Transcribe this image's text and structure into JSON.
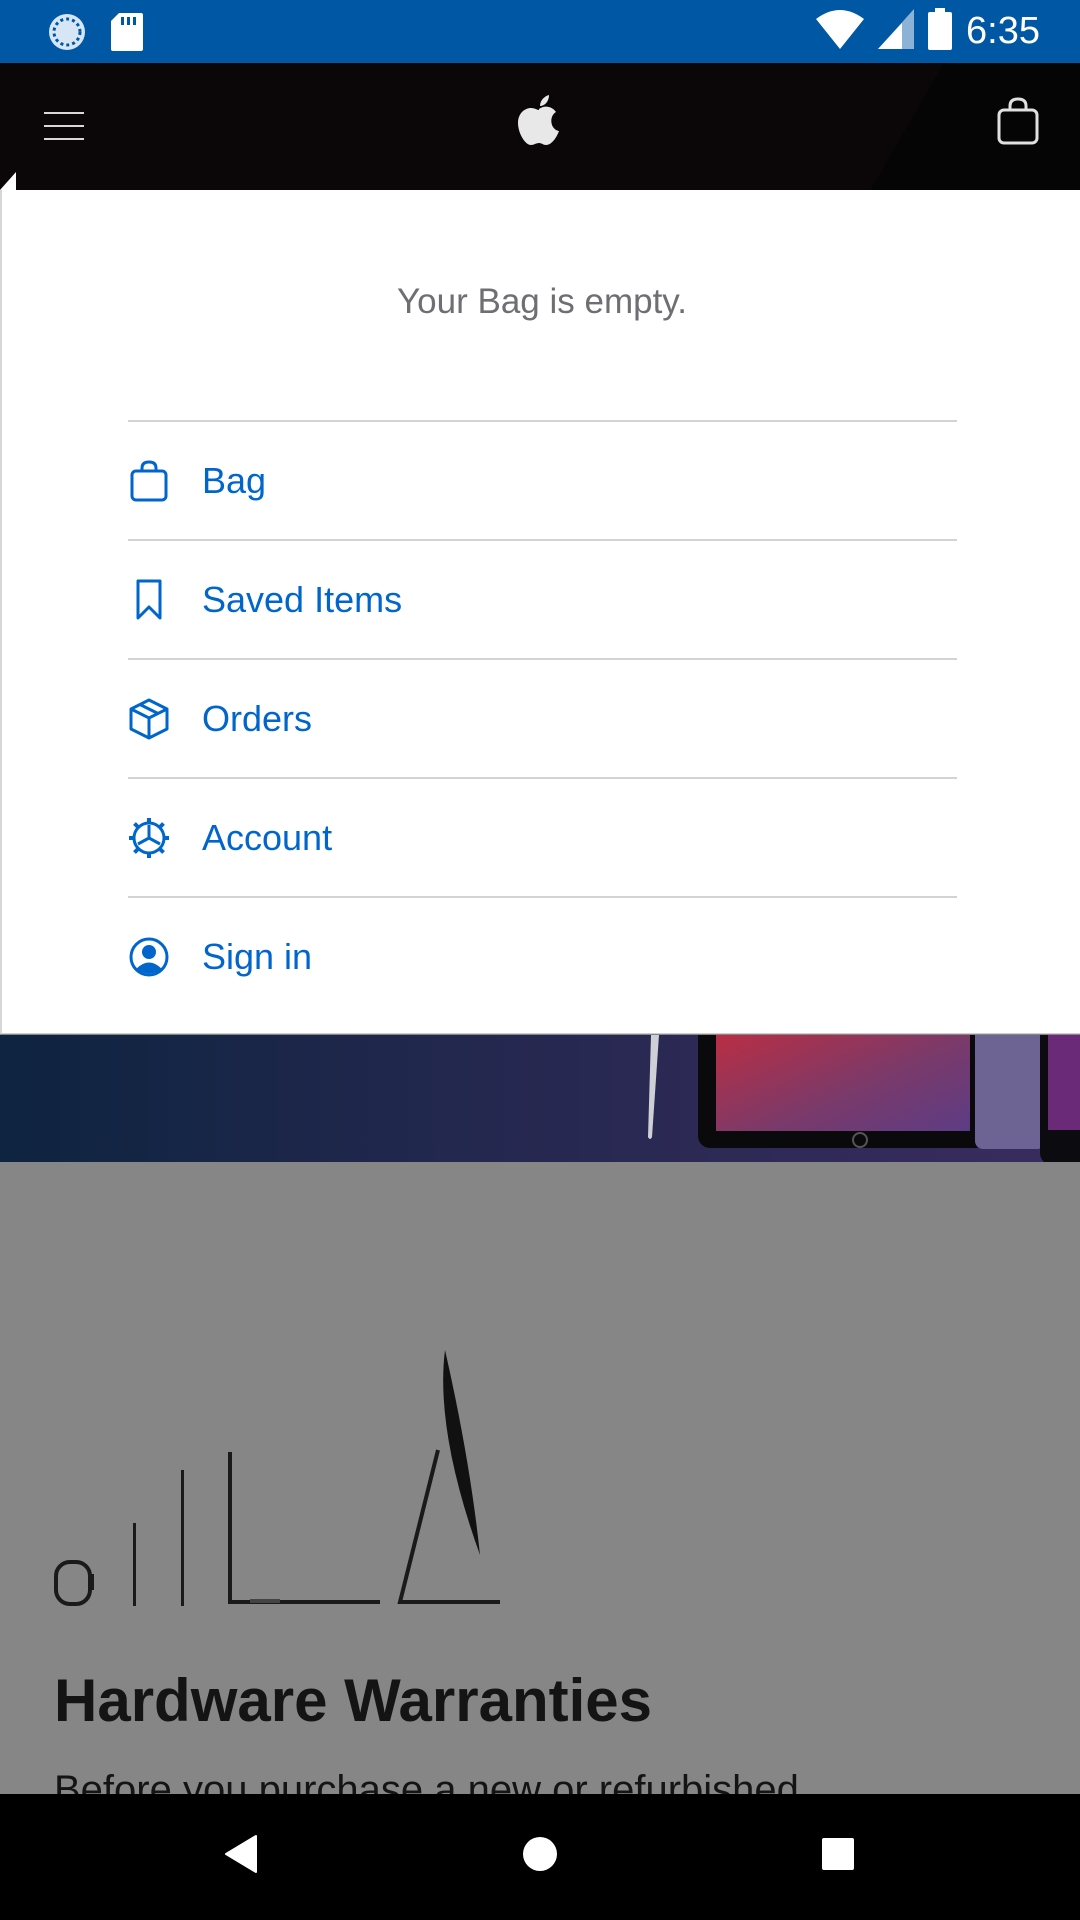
{
  "status_bar": {
    "time": "6:35",
    "left_icons": [
      "sync-icon",
      "sd-card-icon"
    ],
    "right_icons": [
      "wifi-icon",
      "cell-signal-icon",
      "battery-icon"
    ],
    "background": "#0057a3"
  },
  "top_nav": {
    "menu_icon": "hamburger-menu-icon",
    "logo_icon": "apple-logo-icon",
    "bag_icon": "shopping-bag-icon"
  },
  "bag_panel": {
    "empty_message": "Your Bag is empty.",
    "items": [
      {
        "label": "Bag",
        "icon": "bag-icon"
      },
      {
        "label": "Saved Items",
        "icon": "bookmark-icon"
      },
      {
        "label": "Orders",
        "icon": "box-icon"
      },
      {
        "label": "Account",
        "icon": "gear-icon"
      },
      {
        "label": "Sign in",
        "icon": "user-circle-icon"
      }
    ],
    "link_color": "#0066cc"
  },
  "page": {
    "section_title": "Hardware Warranties",
    "section_text": "Before you purchase a new or refurbished"
  },
  "android_nav": {
    "buttons": [
      "back-button",
      "home-button",
      "recents-button"
    ]
  }
}
